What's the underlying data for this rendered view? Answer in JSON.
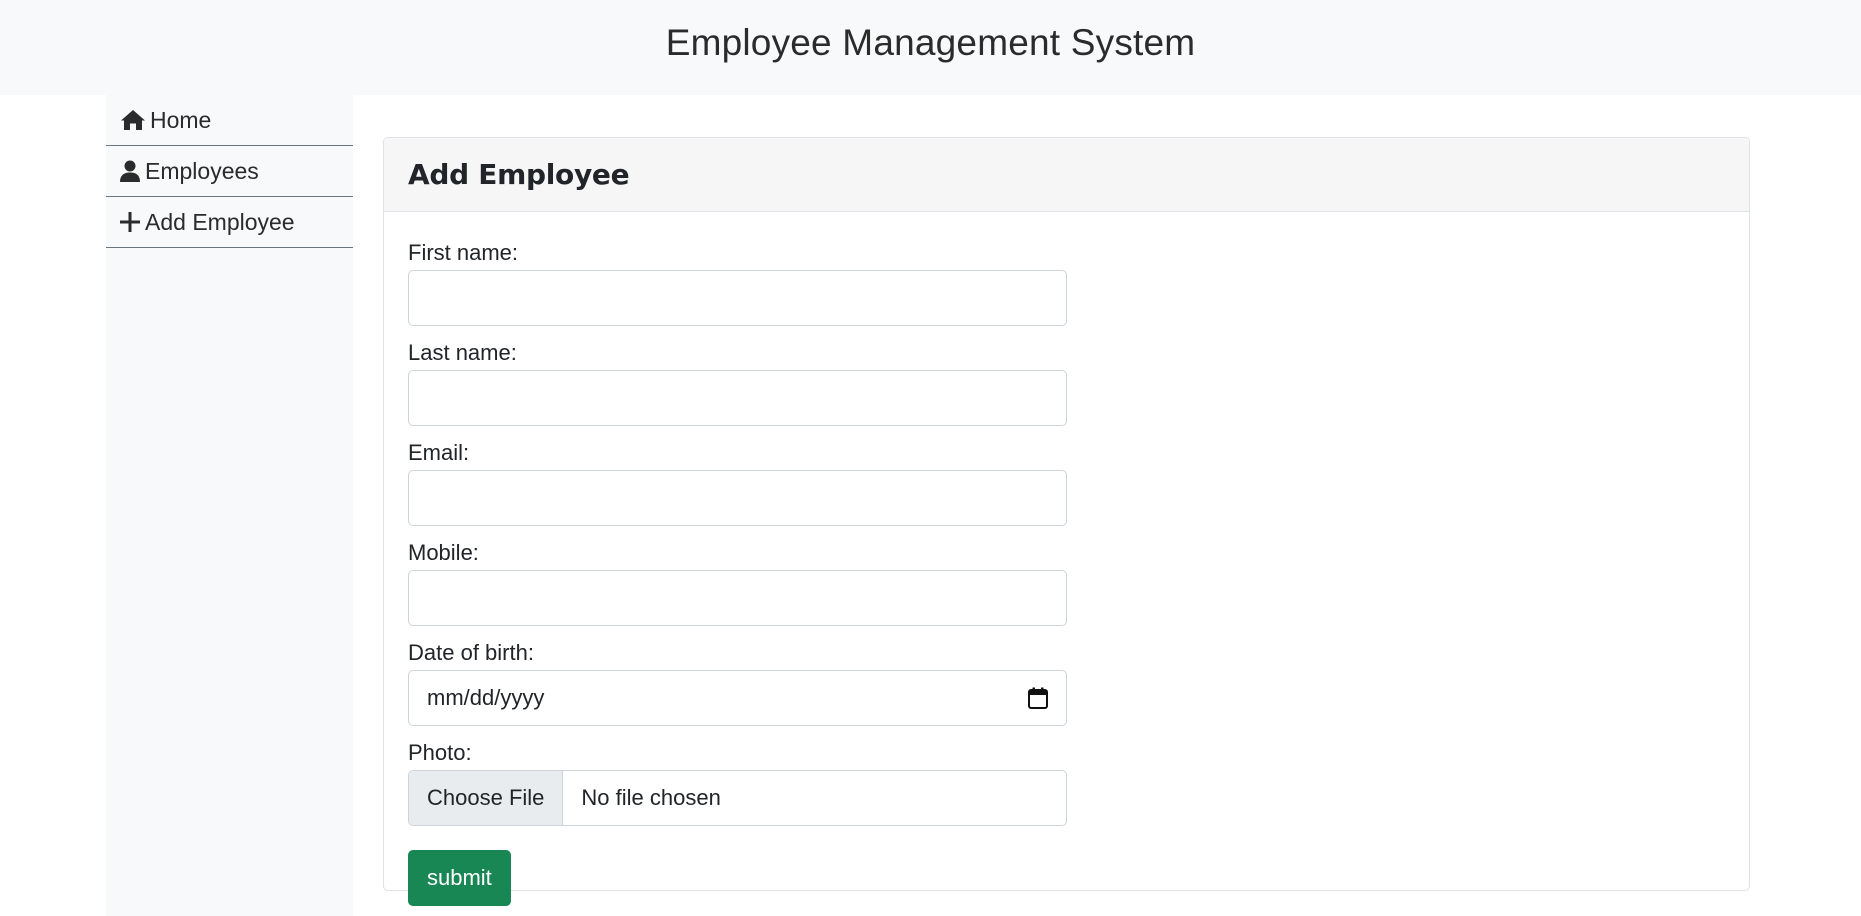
{
  "header": {
    "title": "Employee Management System"
  },
  "sidebar": {
    "items": [
      {
        "label": "Home",
        "icon": "home-icon"
      },
      {
        "label": "Employees",
        "icon": "user-icon"
      },
      {
        "label": "Add Employee",
        "icon": "plus-icon"
      }
    ]
  },
  "card": {
    "title": "Add Employee"
  },
  "form": {
    "first_name": {
      "label": "First name:",
      "value": ""
    },
    "last_name": {
      "label": "Last name:",
      "value": ""
    },
    "email": {
      "label": "Email:",
      "value": ""
    },
    "mobile": {
      "label": "Mobile:",
      "value": ""
    },
    "dob": {
      "label": "Date of birth:",
      "placeholder": "mm/dd/yyyy",
      "icon": "calendar-icon"
    },
    "photo": {
      "label": "Photo:",
      "button_label": "Choose File",
      "status_text": "No file chosen"
    },
    "submit_label": "submit"
  },
  "colors": {
    "header_bg": "#f8f9fa",
    "sidebar_bg": "#f8f9fa",
    "submit_bg": "#198754",
    "card_header_bg": "#f6f6f6"
  }
}
